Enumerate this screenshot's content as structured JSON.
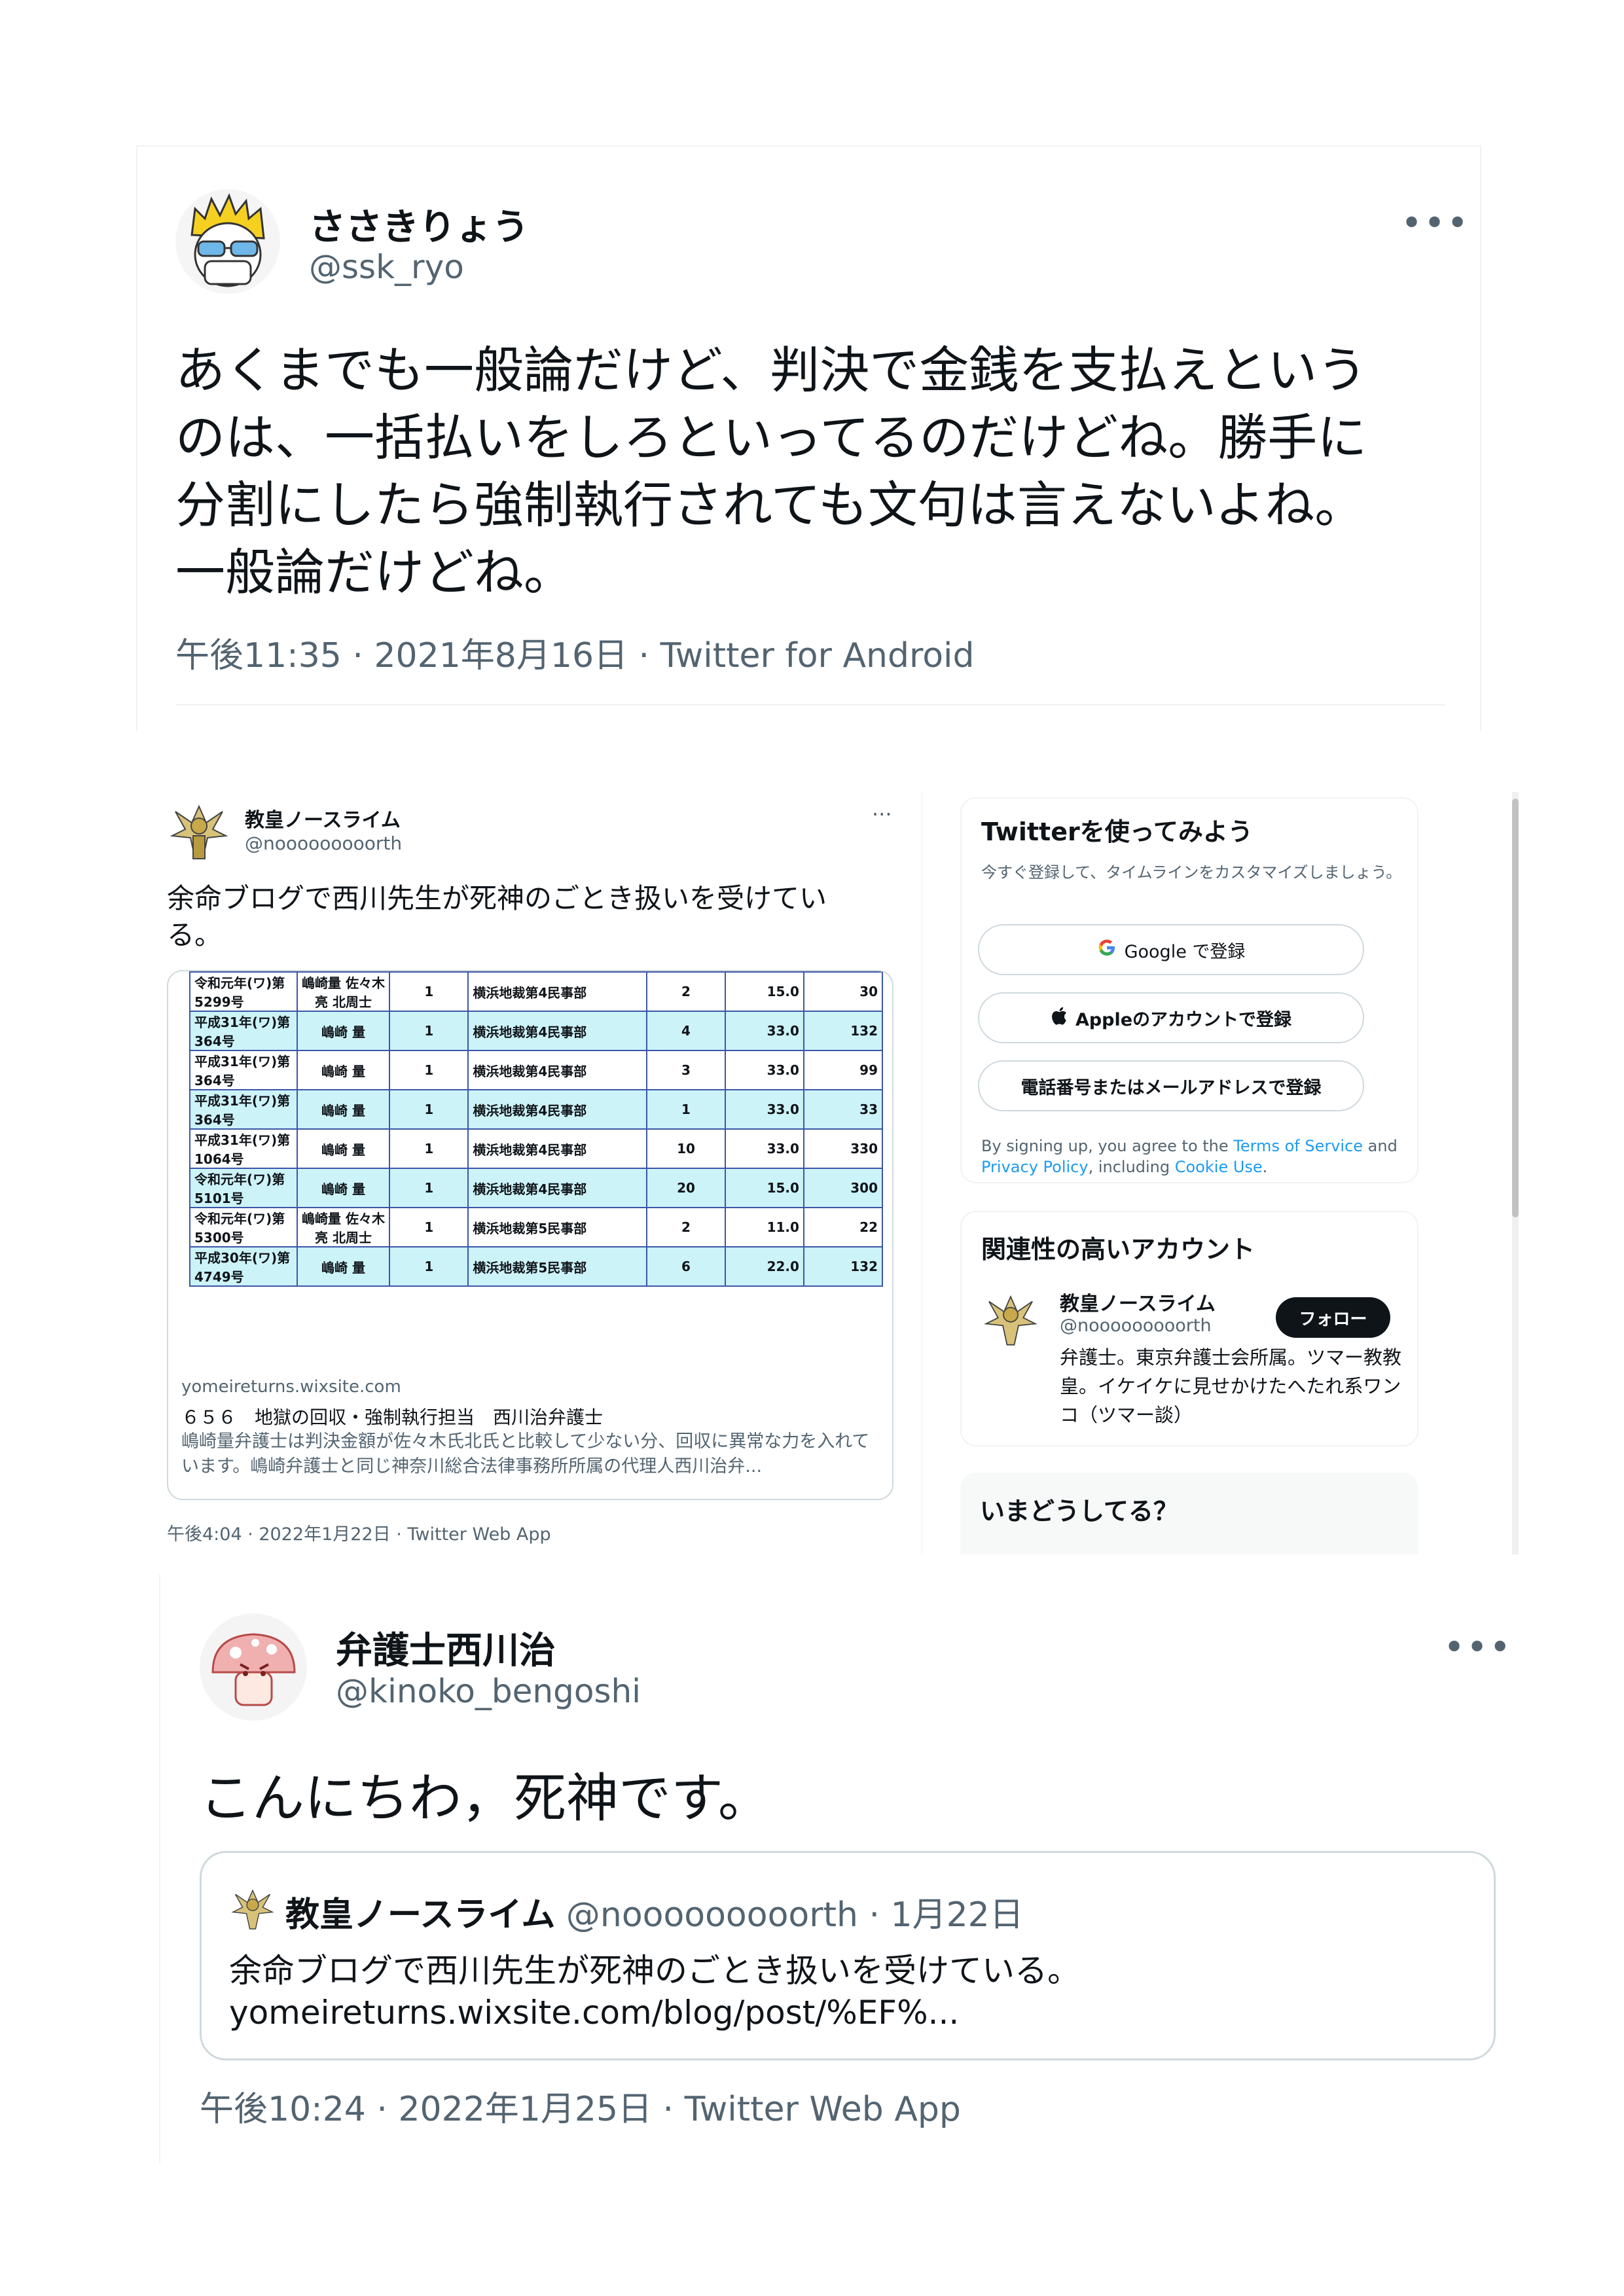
{
  "tweet1": {
    "name": "ささきりょう",
    "handle": "@ssk_ryo",
    "more": "•••",
    "lines": [
      "あくまでも一般論だけど、判決で金銭を支払えという",
      "のは、一括払いをしろといってるのだけどね。勝手に",
      "分割にしたら強制執行されても文句は言えないよね。",
      "一般論だけどね。"
    ],
    "meta": "午後11:35 · 2021年8月16日 · Twitter for Android"
  },
  "middle": {
    "name": "教皇ノースライム",
    "handle": "@nooooooooorth",
    "more": "···",
    "text_lines": [
      "余命ブログで西川先生が死神のごとき扱いを受けてい",
      "る。"
    ],
    "table_rows": [
      [
        "令和元年(ワ)第5299号",
        "嶋崎量 佐々木亮 北周士",
        "1",
        "横浜地裁第4民事部",
        "2",
        "15.0",
        "30"
      ],
      [
        "平成31年(ワ)第364号",
        "嶋崎 量",
        "1",
        "横浜地裁第4民事部",
        "4",
        "33.0",
        "132"
      ],
      [
        "平成31年(ワ)第364号",
        "嶋崎 量",
        "1",
        "横浜地裁第4民事部",
        "3",
        "33.0",
        "99"
      ],
      [
        "平成31年(ワ)第364号",
        "嶋崎 量",
        "1",
        "横浜地裁第4民事部",
        "1",
        "33.0",
        "33"
      ],
      [
        "平成31年(ワ)第1064号",
        "嶋崎 量",
        "1",
        "横浜地裁第4民事部",
        "10",
        "33.0",
        "330"
      ],
      [
        "令和元年(ワ)第5101号",
        "嶋崎 量",
        "1",
        "横浜地裁第4民事部",
        "20",
        "15.0",
        "300"
      ],
      [
        "令和元年(ワ)第5300号",
        "嶋崎量 佐々木亮 北周士",
        "1",
        "横浜地裁第5民事部",
        "2",
        "11.0",
        "22"
      ],
      [
        "平成30年(ワ)第4749号",
        "嶋崎 量",
        "1",
        "横浜地裁第5民事部",
        "6",
        "22.0",
        "132"
      ]
    ],
    "card_domain": "yomeireturns.wixsite.com",
    "card_title": "６５６　地獄の回収・強制執行担当　西川治弁護士",
    "card_desc": "嶋崎量弁護士は判決金額が佐々木氏北氏と比較して少ない分、回収に異常な力を入れています。嶋崎弁護士と同じ神奈川総合法律事務所所属の代理人西川治弁...",
    "meta": "午後4:04 · 2022年1月22日 · Twitter Web App",
    "signup": {
      "heading": "Twitterを使ってみよう",
      "sub": "今すぐ登録して、タイムラインをカスタマイズしましょう。",
      "google": "Google で登録",
      "apple": "Appleのアカウントで登録",
      "phone": "電話番号またはメールアドレスで登録",
      "legal_1": "By signing up, you agree to the ",
      "terms": "Terms of Service",
      "legal_2": " and ",
      "privacy": "Privacy Policy",
      "legal_3": ", including ",
      "cookie": "Cookie Use",
      "legal_4": "."
    },
    "related": {
      "heading": "関連性の高いアカウント",
      "name": "教皇ノースライム",
      "handle": "@nooooooooorth",
      "follow": "フォロー",
      "bio": "弁護士。東京弁護士会所属。ツマー教教皇。イケイケに見せかけたへたれ系ワンコ（ツマー談）"
    },
    "whats_happening": "いまどうしてる？"
  },
  "tweet3": {
    "name": "弁護士西川治",
    "handle": "@kinoko_bengoshi",
    "more": "•••",
    "body": "こんにちわ，死神です。",
    "quote": {
      "name": "教皇ノースライム",
      "handle_date": " @nooooooooorth · 1月22日",
      "text": "余命ブログで西川先生が死神のごとき扱いを受けている。",
      "link": "yomeireturns.wixsite.com/blog/post/%EF%..."
    },
    "meta": "午後10:24 · 2022年1月25日 · Twitter Web App"
  },
  "colors": {
    "text": "#0f1419",
    "muted": "#536471",
    "link": "#1d9bf0",
    "border": "#cfd9de",
    "table_alt": "#ccf3f8",
    "table_border": "#3b56a8"
  }
}
